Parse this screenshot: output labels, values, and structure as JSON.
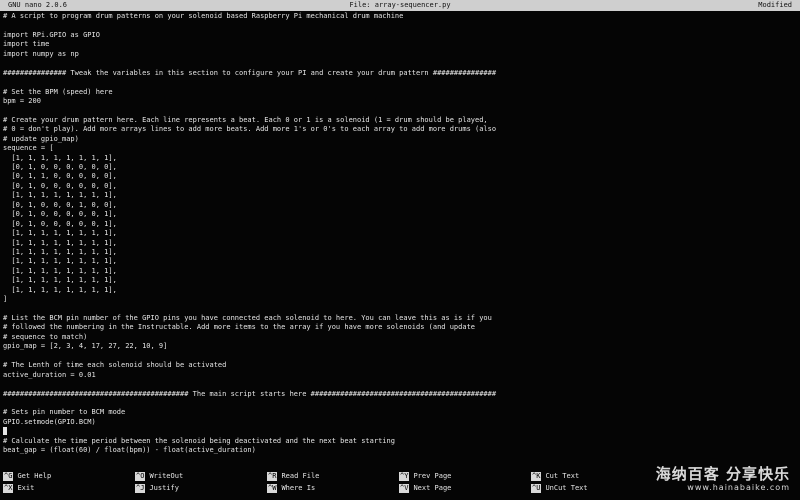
{
  "titlebar": {
    "app": "GNU nano 2.0.6",
    "file": "File: array-sequencer.py",
    "status": "Modified"
  },
  "editor": {
    "lines": [
      "# A script to program drum patterns on your solenoid based Raspberry Pi mechanical drum machine",
      "",
      "import RPi.GPIO as GPIO",
      "import time",
      "import numpy as np",
      "",
      "############### Tweak the variables in this section to configure your PI and create your drum pattern ###############",
      "",
      "# Set the BPM (speed) here",
      "bpm = 200",
      "",
      "# Create your drum pattern here. Each line represents a beat. Each 0 or 1 is a solenoid (1 = drum should be played,",
      "# 0 = don't play). Add more arrays lines to add more beats. Add more 1's or 0's to each array to add more drums (also",
      "# update gpio_map)",
      "sequence = [",
      "  [1, 1, 1, 1, 1, 1, 1, 1],",
      "  [0, 1, 0, 0, 0, 0, 0, 0],",
      "  [0, 1, 1, 0, 0, 0, 0, 0],",
      "  [0, 1, 0, 0, 0, 0, 0, 0],",
      "  [1, 1, 1, 1, 1, 1, 1, 1],",
      "  [0, 1, 0, 0, 0, 1, 0, 0],",
      "  [0, 1, 0, 0, 0, 0, 0, 1],",
      "  [0, 1, 0, 0, 0, 0, 0, 1],",
      "  [1, 1, 1, 1, 1, 1, 1, 1],",
      "  [1, 1, 1, 1, 1, 1, 1, 1],",
      "  [1, 1, 1, 1, 1, 1, 1, 1],",
      "  [1, 1, 1, 1, 1, 1, 1, 1],",
      "  [1, 1, 1, 1, 1, 1, 1, 1],",
      "  [1, 1, 1, 1, 1, 1, 1, 1],",
      "  [1, 1, 1, 1, 1, 1, 1, 1],",
      "]",
      "",
      "# List the BCM pin number of the GPIO pins you have connected each solenoid to here. You can leave this as is if you",
      "# followed the numbering in the Instructable. Add more items to the array if you have more solenoids (and update",
      "# sequence to match)",
      "gpio_map = [2, 3, 4, 17, 27, 22, 10, 9]",
      "",
      "# The Lenth of time each solenoid should be activated",
      "active_duration = 0.01",
      "",
      "############################################ The main script starts here ############################################",
      "",
      "# Sets pin number to BCM mode",
      "GPIO.setmode(GPIO.BCM)",
      "",
      "# Calculate the time period between the solenoid being deactivated and the next beat starting",
      "beat_gap = (float(60) / float(bpm)) - float(active_duration)"
    ]
  },
  "shortcuts": [
    {
      "key": "^G",
      "label": "Get Help"
    },
    {
      "key": "^X",
      "label": "Exit"
    },
    {
      "key": "^O",
      "label": "WriteOut"
    },
    {
      "key": "^J",
      "label": "Justify"
    },
    {
      "key": "^R",
      "label": "Read File"
    },
    {
      "key": "^W",
      "label": "Where Is"
    },
    {
      "key": "^Y",
      "label": "Prev Page"
    },
    {
      "key": "^V",
      "label": "Next Page"
    },
    {
      "key": "^K",
      "label": "Cut Text"
    },
    {
      "key": "^U",
      "label": "UnCut Text"
    }
  ],
  "watermark": {
    "text": "海纳百客 分享快乐",
    "url": "www.hainabaike.com"
  },
  "colors": {
    "background": "#050505",
    "text": "#e6e6e6",
    "titlebar": "#cfcfcf"
  }
}
